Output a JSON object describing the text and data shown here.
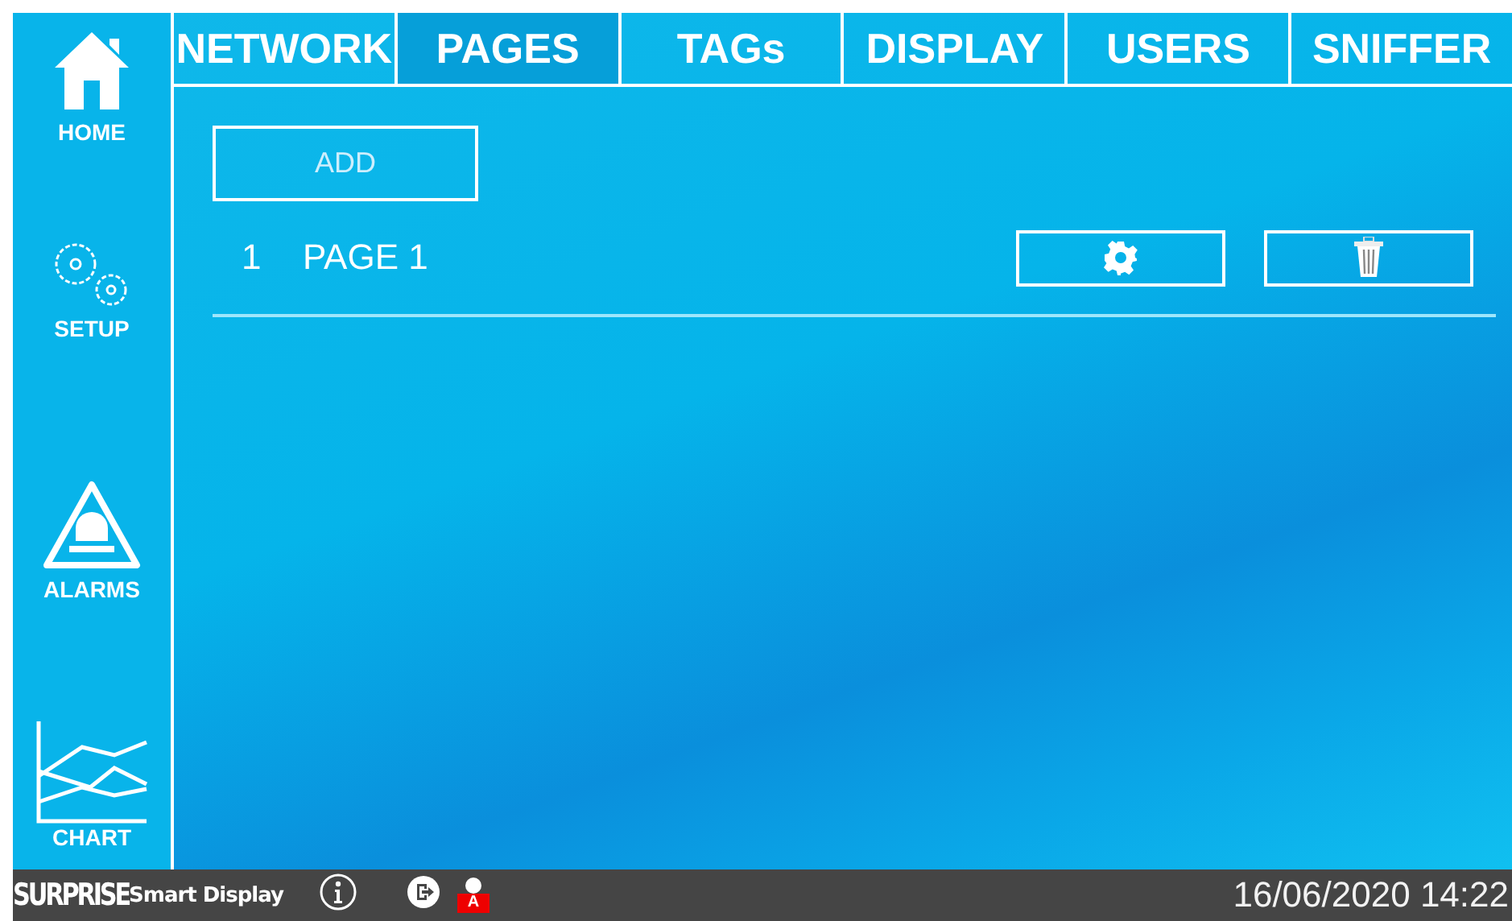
{
  "sidebar": {
    "items": [
      {
        "kind": "home",
        "label": "HOME"
      },
      {
        "kind": "setup",
        "label": "SETUP"
      },
      {
        "kind": "alarms",
        "label": "ALARMS"
      },
      {
        "kind": "chart",
        "label": "CHART"
      }
    ]
  },
  "tabs": [
    {
      "label": "NETWORK",
      "selected": false
    },
    {
      "label": "PAGES",
      "selected": true
    },
    {
      "label": "TAGs",
      "selected": false
    },
    {
      "label": "DISPLAY",
      "selected": false
    },
    {
      "label": "USERS",
      "selected": false
    },
    {
      "label": "SNIFFER",
      "selected": false
    }
  ],
  "add_button": {
    "label": "ADD"
  },
  "pages": [
    {
      "number": "1",
      "name": "PAGE 1"
    }
  ],
  "status_bar": {
    "brand": "SURPRISE",
    "product": "Smart Display",
    "user_badge": "A",
    "datetime": "16/06/2020 14:22"
  }
}
